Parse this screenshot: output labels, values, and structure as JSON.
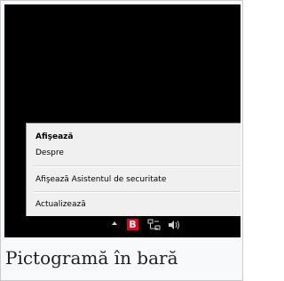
{
  "context_menu": {
    "items": [
      {
        "label": "Afişează",
        "bold": true
      },
      {
        "label": "Despre",
        "bold": false
      },
      {
        "label": "Afişează Asistentul de securitate",
        "bold": false
      },
      {
        "label": "Actualizează",
        "bold": false
      }
    ]
  },
  "tray": {
    "icons": [
      "show-hidden-icons-arrow",
      "bitdefender-icon",
      "network-icon",
      "volume-icon"
    ],
    "b_icon_letter": "B",
    "b_icon_color": "#e3001b"
  },
  "caption": "Pictogramă în bară"
}
